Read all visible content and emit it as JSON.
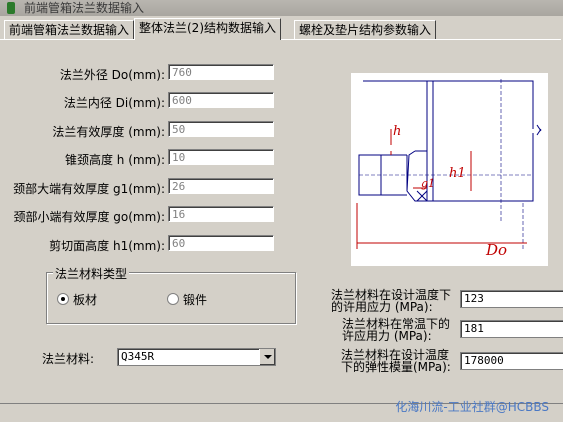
{
  "window": {
    "title": "前端管箱法兰数据输入"
  },
  "tabs": [
    "前端管箱法兰数据输入",
    "整体法兰(2)结构数据输入",
    "螺栓及垫片结构参数输入"
  ],
  "fields": [
    {
      "label": "法兰外径 Do(mm):",
      "value": "760"
    },
    {
      "label": "法兰内径 Di(mm):",
      "value": "600"
    },
    {
      "label": "法兰有效厚度 (mm):",
      "value": "50"
    },
    {
      "label": "锥颈高度 h (mm):",
      "value": "10"
    },
    {
      "label": "颈部大端有效厚度 g1(mm):",
      "value": "26"
    },
    {
      "label": "颈部小端有效厚度 go(mm):",
      "value": "16"
    },
    {
      "label": "剪切面高度 h1(mm):",
      "value": "60"
    }
  ],
  "material_type": {
    "caption": "法兰材料类型",
    "options": [
      "板材",
      "锻件"
    ],
    "selected": "板材"
  },
  "material": {
    "label": "法兰材料:",
    "value": "Q345R"
  },
  "right_fields": [
    {
      "label1": "法兰材料在设计温度下",
      "label2": "的许用应力 (MPa):",
      "value": "123"
    },
    {
      "label1": "法兰材料在常温下的",
      "label2": "许应用力 (MPa):",
      "value": "181"
    },
    {
      "label1": "法兰材料在设计温度",
      "label2": "下的弹性模量(MPa):",
      "value": "178000"
    }
  ],
  "diagram_labels": {
    "h": "h",
    "h1": "h1",
    "g1": "g1",
    "Do": "Do"
  },
  "watermark": "化海川流-工业社群@HCBBS"
}
